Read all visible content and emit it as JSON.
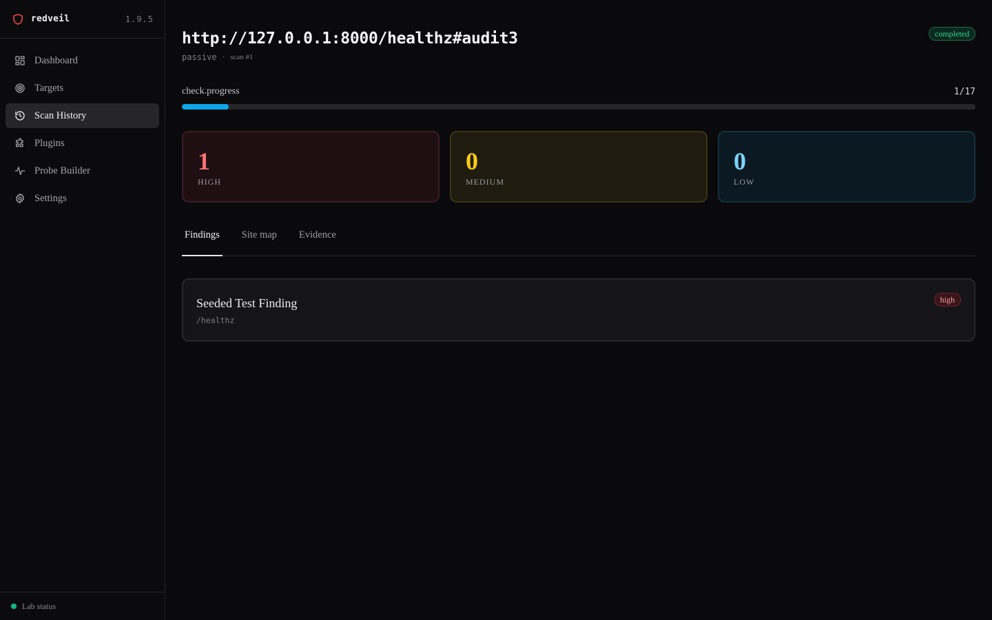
{
  "app": {
    "name": "redveil",
    "version": "1.9.5"
  },
  "sidebar": {
    "items": [
      {
        "label": "Dashboard",
        "icon": "dashboard-icon"
      },
      {
        "label": "Targets",
        "icon": "target-icon"
      },
      {
        "label": "Scan History",
        "icon": "history-icon",
        "active": true
      },
      {
        "label": "Plugins",
        "icon": "puzzle-icon"
      },
      {
        "label": "Probe Builder",
        "icon": "pulse-icon"
      },
      {
        "label": "Settings",
        "icon": "gear-icon"
      }
    ],
    "footer": {
      "label": "Lab status",
      "dot_color": "#10b981"
    }
  },
  "header": {
    "title": "http://127.0.0.1:8000/healthz#audit3",
    "mode": "passive",
    "separator": "·",
    "scan": "scan #1",
    "status": "completed"
  },
  "progress": {
    "label": "check.progress",
    "count": "1/17",
    "fraction": 0.0588,
    "color": "#0ea5e9"
  },
  "severity": {
    "high": {
      "count": "1",
      "label": "HIGH",
      "color": "#f87171"
    },
    "medium": {
      "count": "0",
      "label": "MEDIUM",
      "color": "#facc15"
    },
    "low": {
      "count": "0",
      "label": "LOW",
      "color": "#7dd3fc"
    }
  },
  "tabs": [
    {
      "label": "Findings",
      "active": true
    },
    {
      "label": "Site map"
    },
    {
      "label": "Evidence"
    }
  ],
  "findings": [
    {
      "title": "Seeded Test Finding",
      "path": "/healthz",
      "severity": "high"
    }
  ]
}
